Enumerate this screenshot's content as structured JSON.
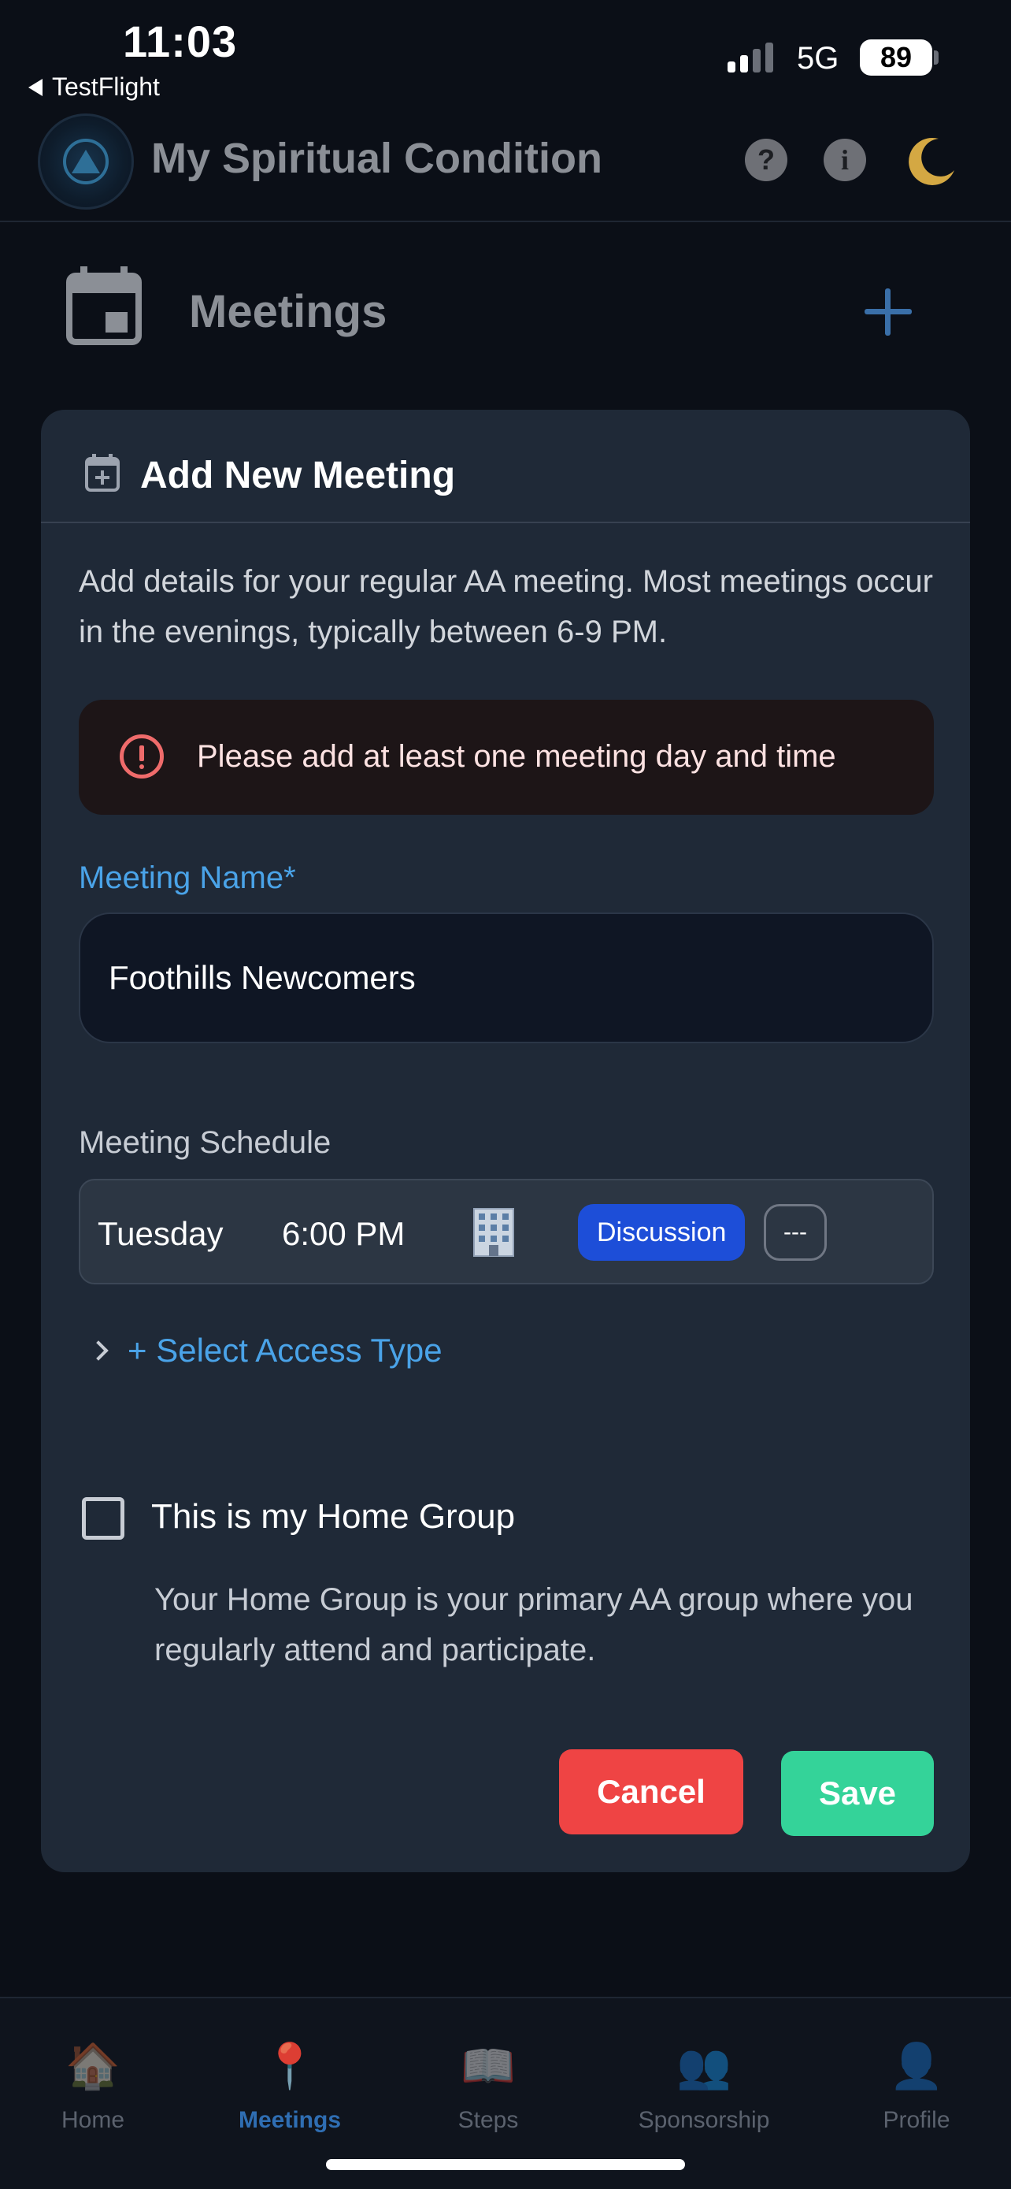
{
  "status_bar": {
    "time": "11:03",
    "back_app": "TestFlight",
    "network": "5G",
    "battery": "89"
  },
  "header": {
    "title": "My Spiritual Condition",
    "help_icon_glyph": "?",
    "info_icon_glyph": "i"
  },
  "page": {
    "title": "Meetings"
  },
  "form": {
    "title": "Add New Meeting",
    "description": "Add details for your regular AA meeting. Most meetings occur in the evenings, typically between 6-9 PM.",
    "alert": "Please add at least one meeting day and time",
    "name_label": "Meeting Name*",
    "name_value": "Foothills Newcomers",
    "schedule_label": "Meeting Schedule",
    "schedule": [
      {
        "day": "Tuesday",
        "time": "6:00 PM",
        "type": "Discussion",
        "extra": "---"
      }
    ],
    "access_type": "+ Select Access Type",
    "home_group_label": "This is my Home Group",
    "home_group_checked": false,
    "home_group_help": "Your Home Group is your primary AA group where you regularly attend and participate.",
    "cancel_label": "Cancel",
    "save_label": "Save"
  },
  "colors": {
    "accent": "#4aa3e8",
    "danger": "#ef4444",
    "success": "#34d399",
    "badge": "#1d4ed8"
  },
  "tabs": [
    {
      "label": "Home",
      "icon": "house-icon",
      "glyph": "🏠",
      "active": false
    },
    {
      "label": "Meetings",
      "icon": "pin-icon",
      "glyph": "📍",
      "active": true
    },
    {
      "label": "Steps",
      "icon": "book-icon",
      "glyph": "📖",
      "active": false
    },
    {
      "label": "Sponsorship",
      "icon": "people-icon",
      "glyph": "👥",
      "active": false
    },
    {
      "label": "Profile",
      "icon": "person-icon",
      "glyph": "👤",
      "active": false
    }
  ]
}
